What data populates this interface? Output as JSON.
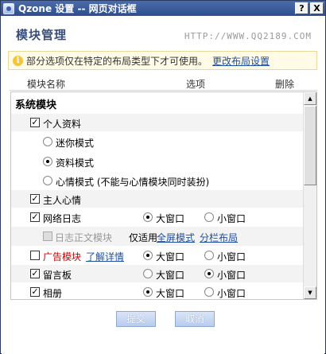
{
  "window": {
    "title": "Qzone 设置 -- 网页对话框",
    "help_label": "?",
    "close_label": "X"
  },
  "header": {
    "title": "模块管理",
    "url": "HTTP://WWW.QQ2189.COM"
  },
  "notice": {
    "icon": "i",
    "text": "部分选项仅在特定的布局类型下才可使用。",
    "link": "更改布局设置"
  },
  "columns": {
    "name": "模块名称",
    "options": "选项",
    "delete": "删除"
  },
  "section": "系统模块",
  "rows": {
    "profile": {
      "label": "个人资料",
      "checked": "✓"
    },
    "mini_mode": {
      "label": "迷你模式"
    },
    "info_mode": {
      "label": "资料模式"
    },
    "mood_mode": {
      "label": "心情模式 (不能与心情模块同时装扮)"
    },
    "owner_mood": {
      "label": "主人心情",
      "checked": "✓"
    },
    "blog": {
      "label": "网络日志",
      "checked": "✓",
      "big": "大窗口",
      "small": "小窗口"
    },
    "blog_body": {
      "label": "日志正文模块",
      "note": "仅适用",
      "link1": "全屏模式",
      "link2": "分栏布局"
    },
    "ads": {
      "label": "广告模块",
      "link": "了解详情",
      "big": "大窗口",
      "small": "小窗口"
    },
    "guestbook": {
      "label": "留言板",
      "checked": "✓",
      "big": "大窗口",
      "small": "小窗口"
    },
    "album": {
      "label": "相册",
      "checked": "✓",
      "big": "大窗口",
      "small": "小窗口"
    }
  },
  "scrollbar": {
    "up": "▲",
    "down": "▼"
  },
  "footer": {
    "submit": "提交",
    "cancel": "取消"
  }
}
